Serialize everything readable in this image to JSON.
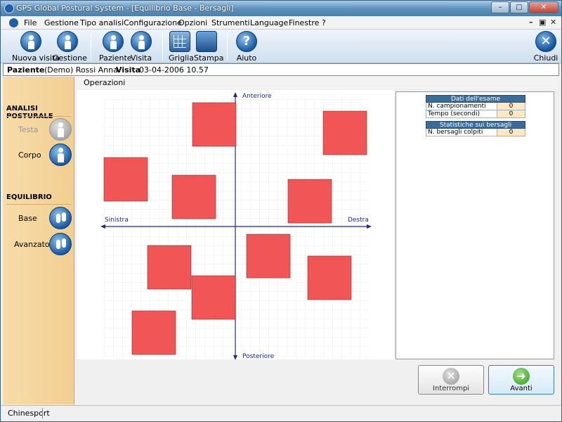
{
  "window": {
    "title": "GPS Global Postural System - [Equilibrio Base - Bersagli]"
  },
  "menu": [
    "File",
    "Gestione",
    "Tipo analisi",
    "Configurazione",
    "Opzioni",
    "Strumenti",
    "Language",
    "Finestre",
    "?"
  ],
  "toolbar": {
    "new_visit": "Nuova visita",
    "management": "Gestione",
    "patient": "Paziente",
    "visit": "Visita",
    "grid": "Griglia",
    "print": "Stampa",
    "help": "Aiuto",
    "close": "Chiudi"
  },
  "patient_bar": {
    "patient_label": "Paziente",
    "patient_name": "(Demo) Rossi Anna",
    "visit_label": "Visita",
    "visit_date": "03-04-2006 10.57"
  },
  "sidebar": {
    "section1": "ANALISI POSTURALE",
    "head": "Testa",
    "body": "Corpo",
    "section2": "EQUILIBRIO",
    "base": "Base",
    "advanced": "Avanzato"
  },
  "operations_label": "Operazioni",
  "plot": {
    "anterior": "Anteriore",
    "posterior": "Posteriore",
    "left": "Sinistra",
    "right": "Destra",
    "target_color": "#f25555",
    "targets_count": 10
  },
  "exam_table": {
    "title": "Dati dell'esame",
    "rows": [
      {
        "label": "N. campionamenti",
        "value": "0"
      },
      {
        "label": "Tempo (secondi)",
        "value": "0"
      }
    ]
  },
  "targets_table": {
    "title": "Statistiche sui bersagli",
    "rows": [
      {
        "label": "N. bersagli colpiti",
        "value": "0"
      }
    ]
  },
  "buttons": {
    "interrupt": "Interrompi",
    "next": "Avanti"
  },
  "status": {
    "text": "Chinesport"
  }
}
